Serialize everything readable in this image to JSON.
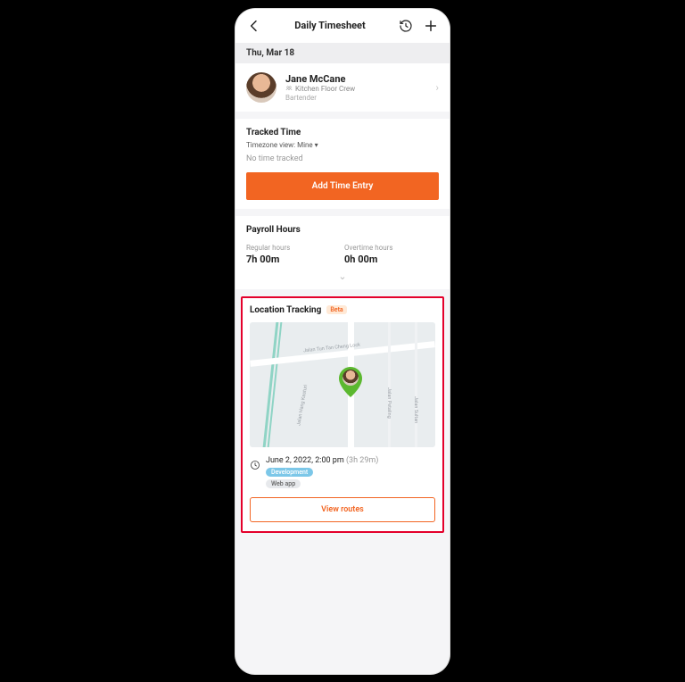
{
  "header": {
    "title": "Daily Timesheet"
  },
  "date": "Thu, Mar 18",
  "person": {
    "name": "Jane McCane",
    "crew": "Kitchen Floor Crew",
    "role": "Bartender"
  },
  "tracked": {
    "title": "Tracked Time",
    "timezone": "Timezone view: Mine ▾",
    "empty": "No time tracked",
    "cta": "Add Time Entry"
  },
  "payroll": {
    "title": "Payroll Hours",
    "regular_label": "Regular hours",
    "regular_value": "7h 00m",
    "overtime_label": "Overtime hours",
    "overtime_value": "0h 00m"
  },
  "location": {
    "title": "Location Tracking",
    "badge": "Beta",
    "street": "Jalan Tun Tan Cheng Lock",
    "street2": "Jalan Hang Kasturi",
    "street3": "Jalan Sultan",
    "street4": "Jalan Petaling",
    "timestamp": "June 2, 2022, 2:00 pm",
    "duration": "(3h 29m)",
    "chip1": "Development",
    "chip2": "Web app",
    "cta": "View routes"
  }
}
